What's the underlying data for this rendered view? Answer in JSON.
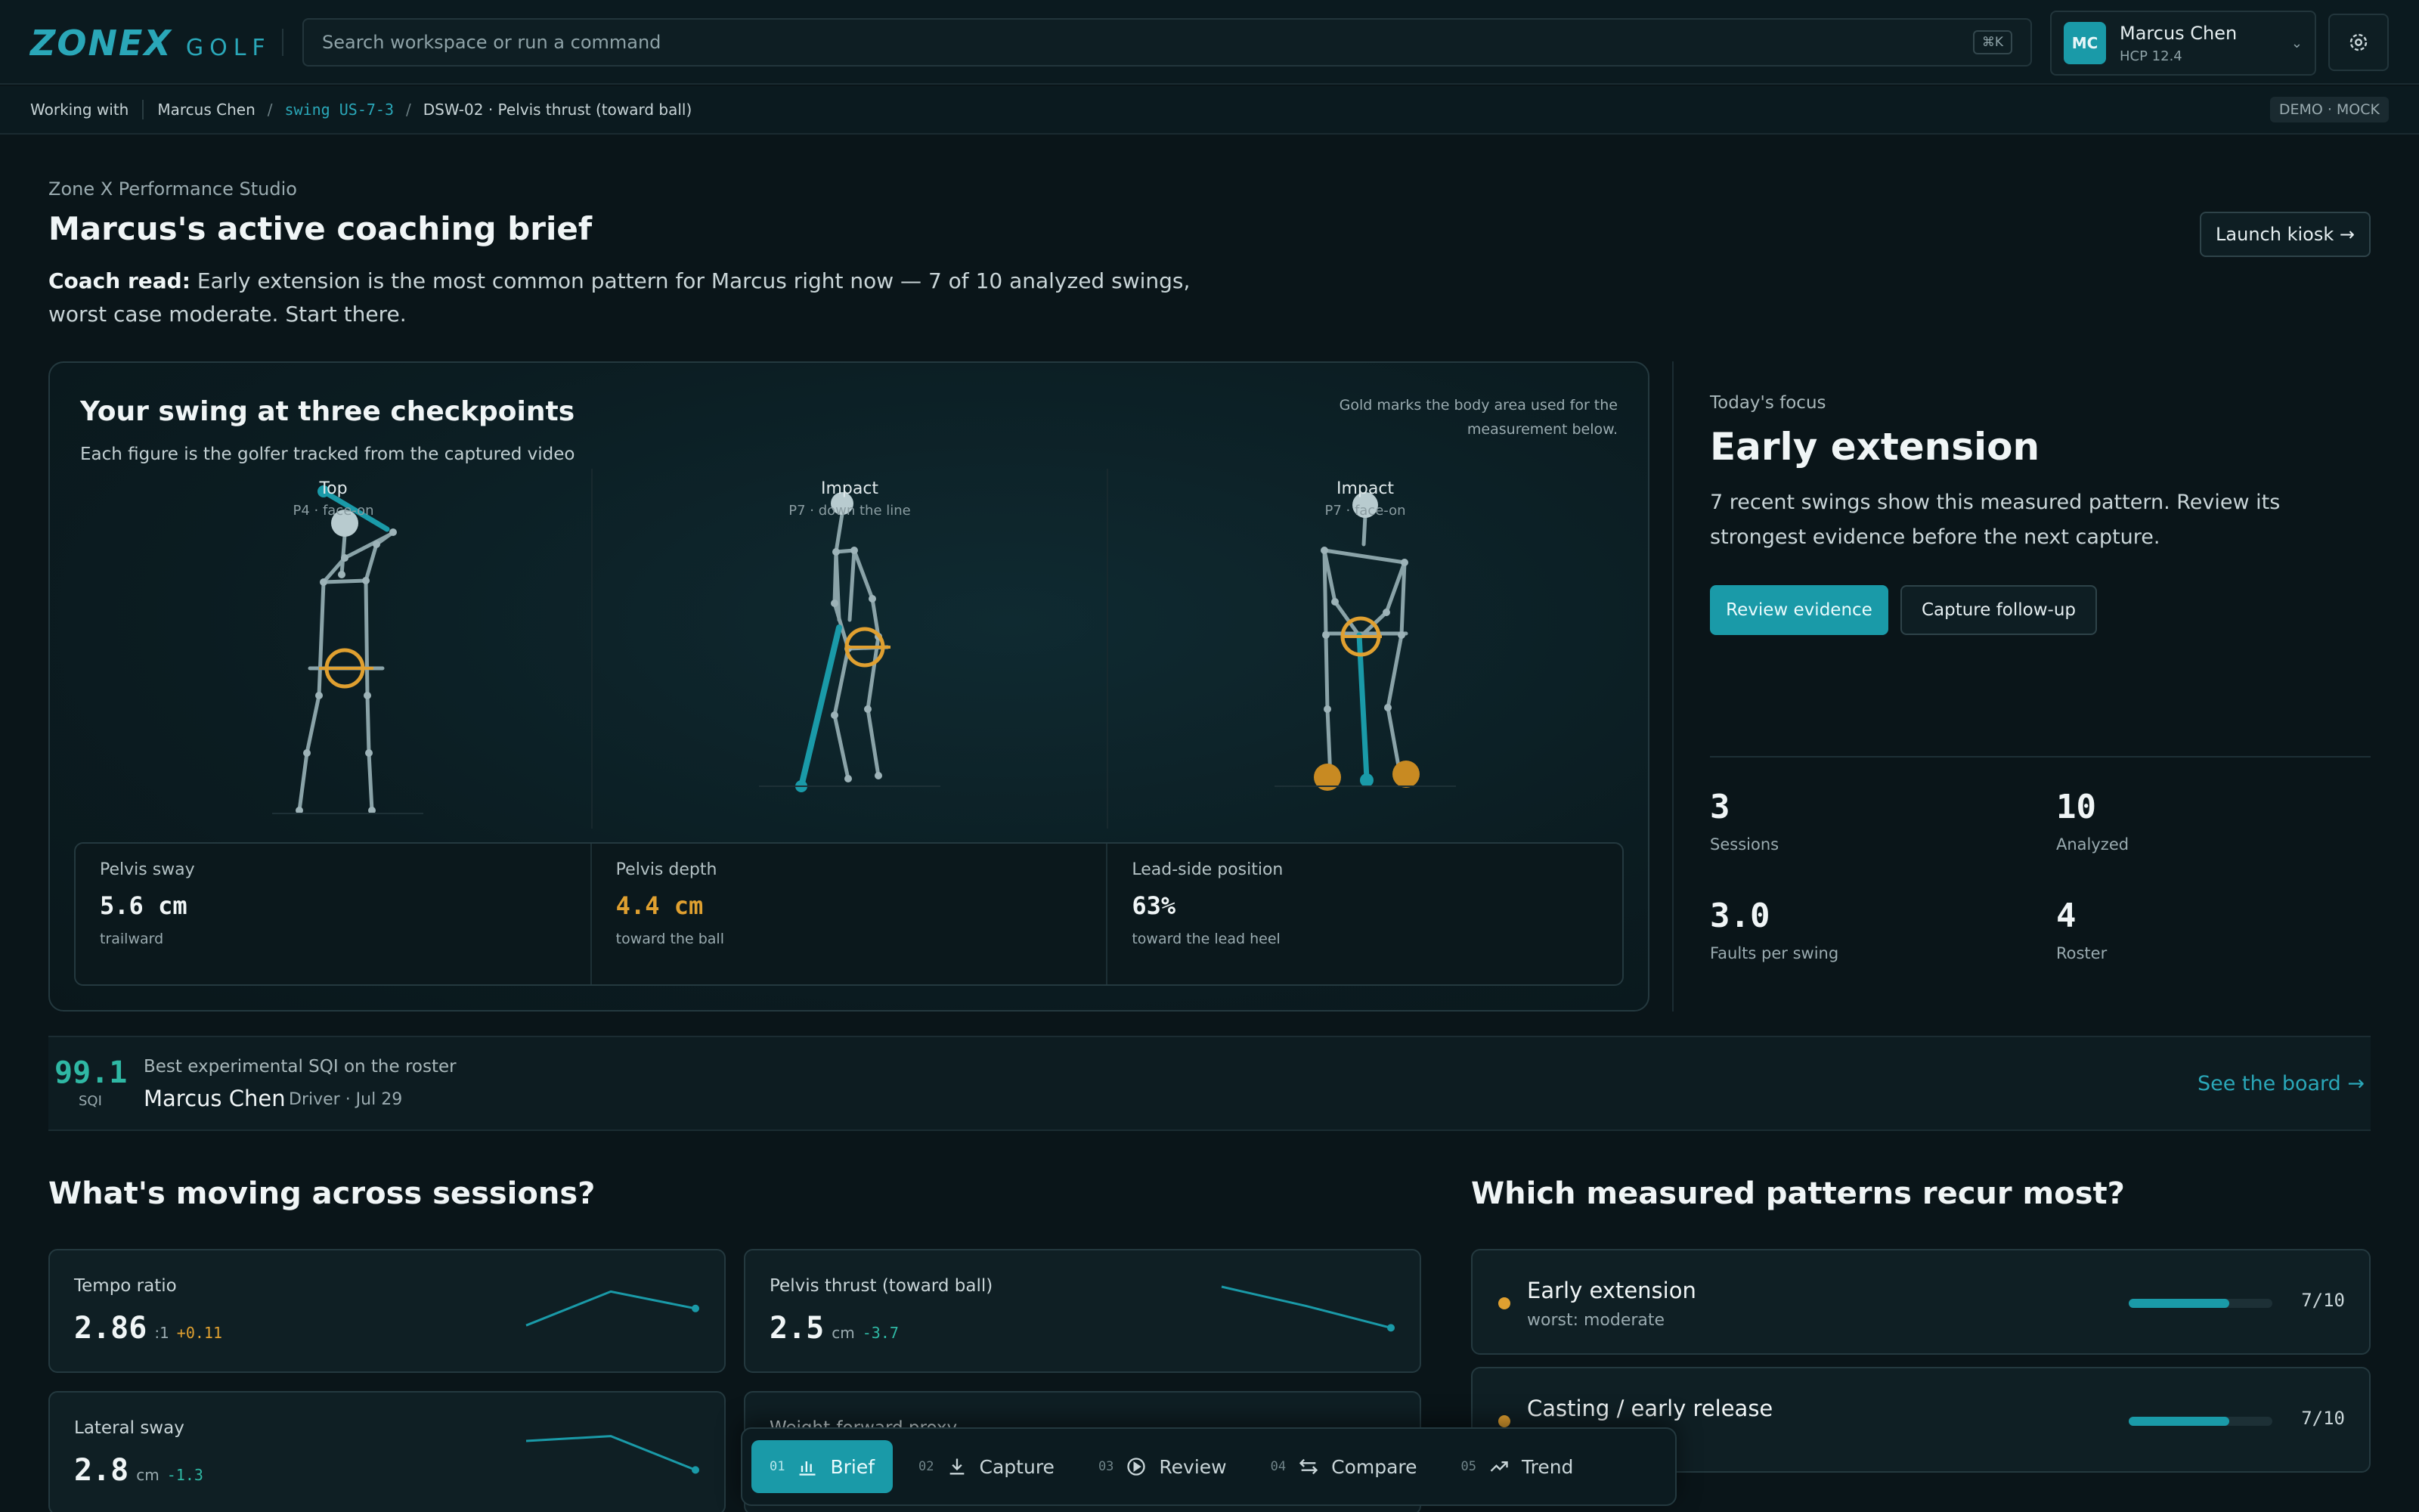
{
  "app": {
    "logo_main": "ZONEX",
    "logo_sub": "GOLF"
  },
  "search": {
    "placeholder": "Search workspace or run a command",
    "shortcut": "⌘K"
  },
  "user": {
    "initials": "MC",
    "name": "Marcus Chen",
    "hcp": "HCP 12.4"
  },
  "breadcrumb": {
    "prefix": "Working with",
    "player": "Marcus Chen",
    "swing": "swing US-7-3",
    "item": "DSW-02 · Pelvis thrust (toward ball)",
    "badge": "DEMO · MOCK"
  },
  "intro": {
    "studio": "Zone X Performance Studio",
    "title": "Marcus's active coaching brief",
    "coach_label": "Coach read:",
    "coach_text": "Early extension is the most common pattern for Marcus right now — 7 of 10 analyzed swings, worst case moderate. Start there.",
    "launch_label": "Launch kiosk →"
  },
  "checkpoints": {
    "title": "Your swing at three checkpoints",
    "subtitle": "Each figure is the golfer tracked from the captured video",
    "note": "Gold marks the body area used for the measurement below.",
    "figures": [
      {
        "name": "Top",
        "phase": "P4 · face-on"
      },
      {
        "name": "Impact",
        "phase": "P7 · down the line"
      },
      {
        "name": "Impact",
        "phase": "P7 · face-on"
      }
    ],
    "metrics": [
      {
        "label": "Pelvis sway",
        "value": "5.6 cm",
        "note": "trailward",
        "highlight": false
      },
      {
        "label": "Pelvis depth",
        "value": "4.4 cm",
        "note": "toward the ball",
        "highlight": true
      },
      {
        "label": "Lead-side position",
        "value": "63%",
        "note": "toward the lead heel",
        "highlight": false
      }
    ]
  },
  "focus": {
    "kicker": "Today's focus",
    "title": "Early extension",
    "text": "7 recent swings show this measured pattern. Review its strongest evidence before the next capture.",
    "primary_label": "Review evidence",
    "secondary_label": "Capture follow-up",
    "stats": [
      {
        "value": "3",
        "label": "Sessions"
      },
      {
        "value": "10",
        "label": "Analyzed"
      },
      {
        "value": "3.0",
        "label": "Faults per swing"
      },
      {
        "value": "4",
        "label": "Roster"
      }
    ]
  },
  "sqi": {
    "value": "99.1",
    "unit": "SQI",
    "kicker": "Best experimental SQI on the roster",
    "name": "Marcus Chen",
    "meta": "Driver · Jul 29",
    "link": "See the board →"
  },
  "trends": {
    "title": "What's moving across sessions?",
    "cards": [
      {
        "label": "Tempo ratio",
        "value": "2.86",
        "unit": ":1",
        "delta": "+0.11",
        "direction": "up",
        "spark": [
          0.2,
          0.9,
          0.55
        ]
      },
      {
        "label": "Pelvis thrust (toward ball)",
        "value": "2.5",
        "unit": "cm",
        "delta": "-3.7",
        "direction": "down",
        "spark": [
          1.0,
          0.6,
          0.15
        ]
      },
      {
        "label": "Lateral sway",
        "value": "2.8",
        "unit": "cm",
        "delta": "-1.3",
        "direction": "down",
        "spark": [
          0.75,
          0.85,
          0.15
        ]
      },
      {
        "label": "Weight-forward proxy",
        "value": "",
        "unit": "",
        "delta": "",
        "direction": "up",
        "spark": []
      }
    ]
  },
  "patterns": {
    "title": "Which measured patterns recur most?",
    "items": [
      {
        "name": "Early extension",
        "sub": "worst: moderate",
        "count": "7/10",
        "fraction": 0.7
      },
      {
        "name": "Casting / early release",
        "sub": "",
        "count": "7/10",
        "fraction": 0.7
      }
    ]
  },
  "nav": {
    "items": [
      {
        "num": "01",
        "label": "Brief",
        "icon": "bar-chart-icon",
        "active": true
      },
      {
        "num": "02",
        "label": "Capture",
        "icon": "download-icon",
        "active": false
      },
      {
        "num": "03",
        "label": "Review",
        "icon": "play-circle-icon",
        "active": false
      },
      {
        "num": "04",
        "label": "Compare",
        "icon": "swap-arrows-icon",
        "active": false
      },
      {
        "num": "05",
        "label": "Trend",
        "icon": "trend-up-icon",
        "active": false
      }
    ]
  },
  "colors": {
    "accent": "#1a9aa8",
    "gold": "#e0a030",
    "positive": "#2fb8a4",
    "background": "#0a1519"
  }
}
